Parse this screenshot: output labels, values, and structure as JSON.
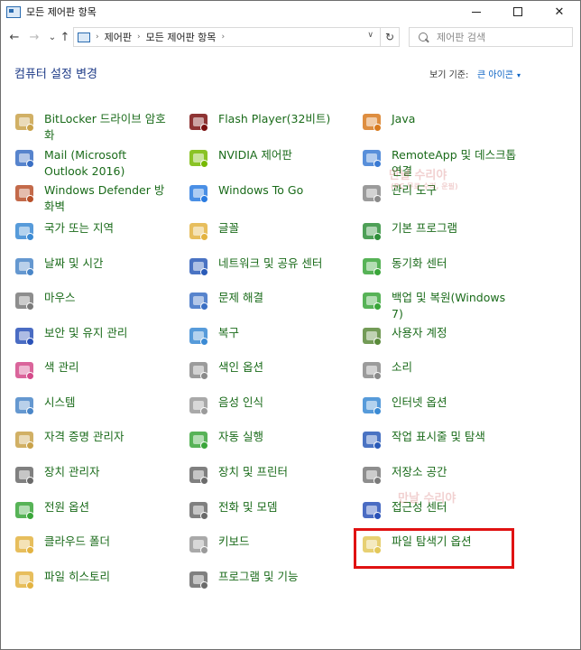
{
  "window": {
    "title": "모든 제어판 항목",
    "controls": {
      "min": "minimize",
      "max": "maximize",
      "close": "✕"
    }
  },
  "nav": {
    "back": "←",
    "forward": "→",
    "dropdown": "⌄",
    "up": "↑",
    "breadcrumb": [
      "제어판",
      "모든 제어판 항목"
    ],
    "breadcrumb_sep": "›",
    "address_dropdown": "∨",
    "refresh": "↻",
    "search_placeholder": "제어판 검색"
  },
  "header": {
    "title": "컴퓨터 설정 변경",
    "view_by_label": "보기 기준:",
    "view_by_value": "큰 아이콘",
    "view_by_arrow": "▾"
  },
  "items": [
    {
      "label": "BitLocker 드라이브 암호화",
      "icon": "bitlocker-icon",
      "color": "#c9a24a"
    },
    {
      "label": "Flash Player(32비트)",
      "icon": "flash-icon",
      "color": "#7a1010"
    },
    {
      "label": "Java",
      "icon": "java-icon",
      "color": "#d87a1e"
    },
    {
      "label": "Mail (Microsoft Outlook 2016)",
      "icon": "mail-icon",
      "color": "#3a6fc4"
    },
    {
      "label": "NVIDIA 제어판",
      "icon": "nvidia-icon",
      "color": "#76b900"
    },
    {
      "label": "RemoteApp 및 데스크톱 연결",
      "icon": "remoteapp-icon",
      "color": "#3b7bd4"
    },
    {
      "label": "Windows Defender 방화벽",
      "icon": "firewall-icon",
      "color": "#b8502a"
    },
    {
      "label": "Windows To Go",
      "icon": "windows-to-go-icon",
      "color": "#2a7be0"
    },
    {
      "label": "관리 도구",
      "icon": "admin-tools-icon",
      "color": "#8a8a8a"
    },
    {
      "label": "국가 또는 지역",
      "icon": "region-icon",
      "color": "#3a8ad4"
    },
    {
      "label": "글꼴",
      "icon": "fonts-icon",
      "color": "#e3b341"
    },
    {
      "label": "기본 프로그램",
      "icon": "default-programs-icon",
      "color": "#2f8f3a"
    },
    {
      "label": "날짜 및 시간",
      "icon": "datetime-icon",
      "color": "#4a86c8"
    },
    {
      "label": "네트워크 및 공유 센터",
      "icon": "network-icon",
      "color": "#2a5bb8"
    },
    {
      "label": "동기화 센터",
      "icon": "sync-icon",
      "color": "#3aa63a"
    },
    {
      "label": "마우스",
      "icon": "mouse-icon",
      "color": "#7a7a7a"
    },
    {
      "label": "문제 해결",
      "icon": "troubleshoot-icon",
      "color": "#3a6fc4"
    },
    {
      "label": "백업 및 복원(Windows 7)",
      "icon": "backup-icon",
      "color": "#3aa63a"
    },
    {
      "label": "보안 및 유지 관리",
      "icon": "security-flag-icon",
      "color": "#2a52b8"
    },
    {
      "label": "복구",
      "icon": "recovery-icon",
      "color": "#3a8ad4"
    },
    {
      "label": "사용자 계정",
      "icon": "user-accounts-icon",
      "color": "#5a8a3a"
    },
    {
      "label": "색 관리",
      "icon": "color-management-icon",
      "color": "#d44a8a"
    },
    {
      "label": "색인 옵션",
      "icon": "indexing-icon",
      "color": "#8a8a8a"
    },
    {
      "label": "소리",
      "icon": "sound-icon",
      "color": "#8a8a8a"
    },
    {
      "label": "시스템",
      "icon": "system-icon",
      "color": "#4a86c8"
    },
    {
      "label": "음성 인식",
      "icon": "speech-icon",
      "color": "#9a9a9a"
    },
    {
      "label": "인터넷 옵션",
      "icon": "internet-options-icon",
      "color": "#3a8ad4"
    },
    {
      "label": "자격 증명 관리자",
      "icon": "credential-icon",
      "color": "#c9a24a"
    },
    {
      "label": "자동 실행",
      "icon": "autoplay-icon",
      "color": "#3aa63a"
    },
    {
      "label": "작업 표시줄 및 탐색",
      "icon": "taskbar-icon",
      "color": "#2a5bb8"
    },
    {
      "label": "장치 관리자",
      "icon": "device-manager-icon",
      "color": "#6a6a6a"
    },
    {
      "label": "장치 및 프린터",
      "icon": "printer-icon",
      "color": "#6a6a6a"
    },
    {
      "label": "저장소 공간",
      "icon": "storage-icon",
      "color": "#7a7a7a"
    },
    {
      "label": "전원 옵션",
      "icon": "power-icon",
      "color": "#3aa63a"
    },
    {
      "label": "전화 및 모뎀",
      "icon": "phone-icon",
      "color": "#6a6a6a"
    },
    {
      "label": "접근성 센터",
      "icon": "ease-of-access-icon",
      "color": "#2a52b8"
    },
    {
      "label": "클라우드 폴더",
      "icon": "work-folders-icon",
      "color": "#e3b341"
    },
    {
      "label": "키보드",
      "icon": "keyboard-icon",
      "color": "#9a9a9a"
    },
    {
      "label": "파일 탐색기 옵션",
      "icon": "folder-options-icon",
      "color": "#e3c85a"
    },
    {
      "label": "파일 히스토리",
      "icon": "file-history-icon",
      "color": "#e3b341"
    },
    {
      "label": "프로그램 및 기능",
      "icon": "programs-icon",
      "color": "#6a6a6a"
    }
  ],
  "watermarks": [
    "만날 수리야",
    "(PC 무료 수리, 운필)",
    "만날 수리야"
  ],
  "accent": {
    "highlight": "#e01212",
    "link": "#0a62c4",
    "heading": "#1e3b87",
    "item_text": "#1a6b1a"
  }
}
